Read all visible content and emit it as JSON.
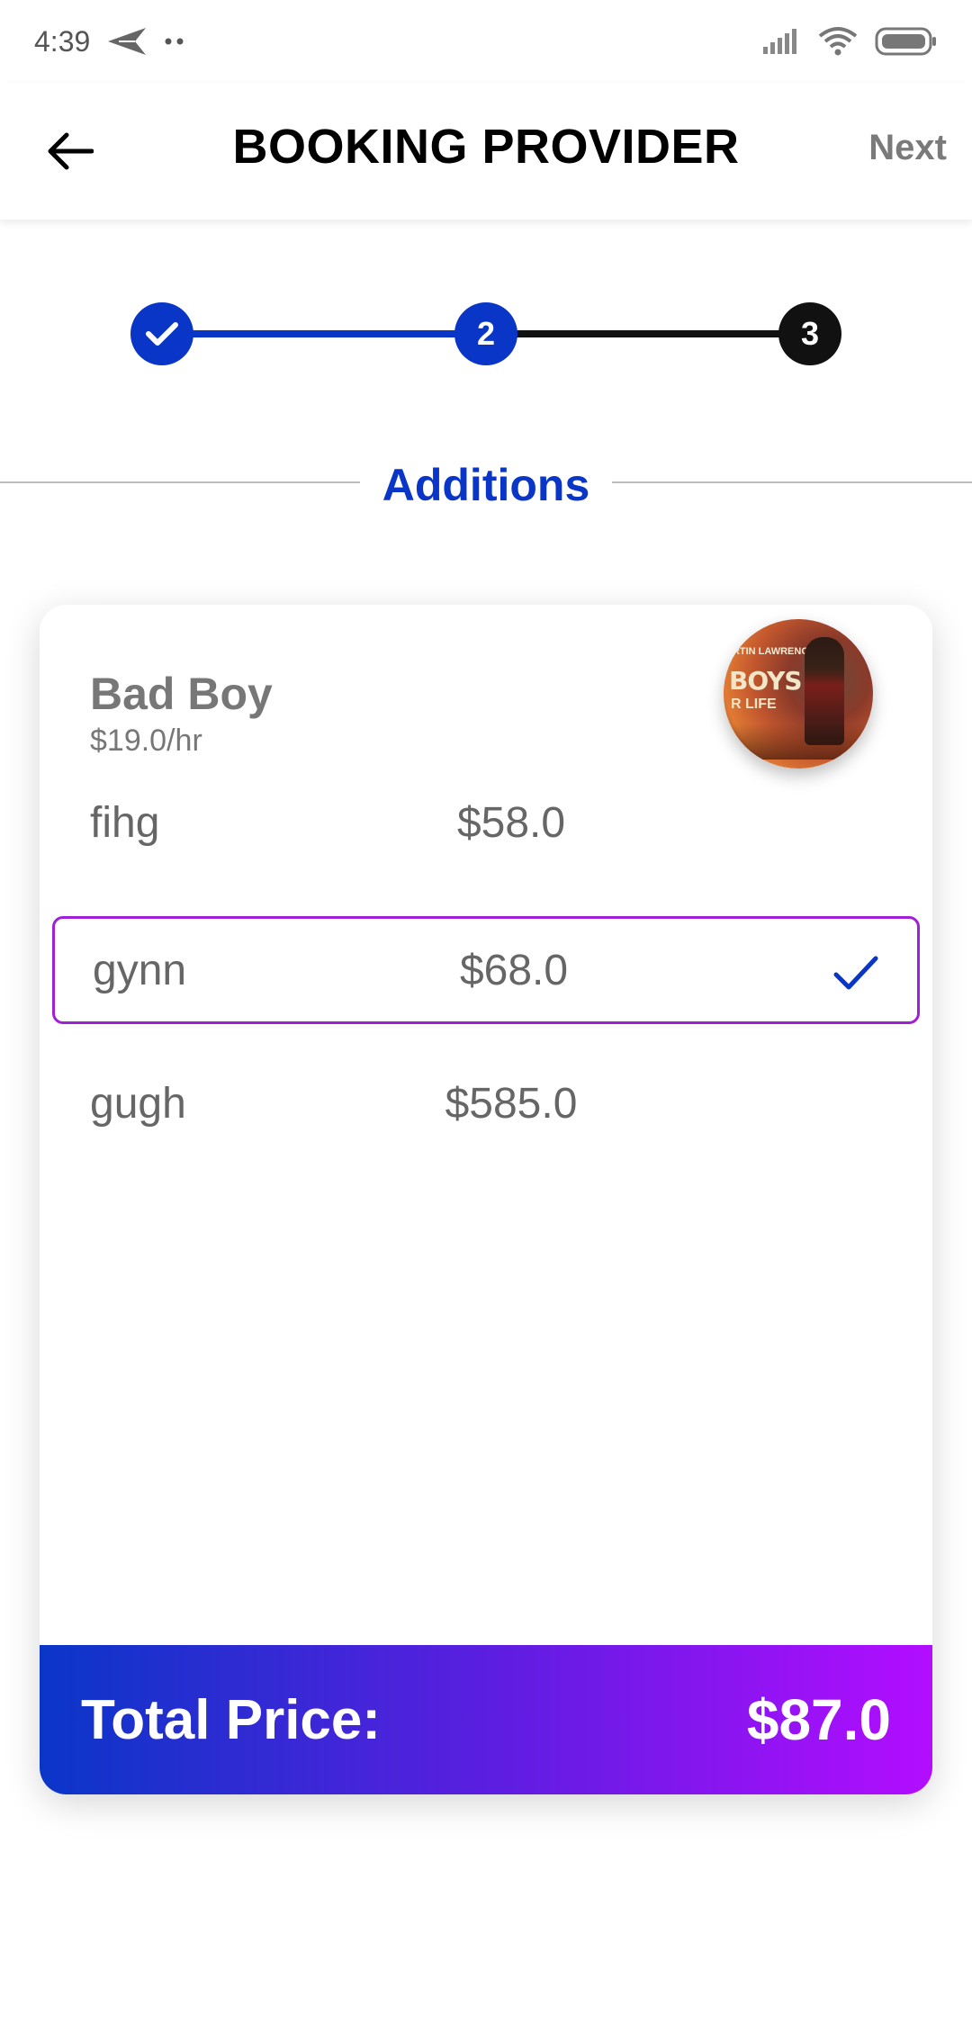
{
  "status_bar": {
    "time": "4:39",
    "left_icons": [
      "send-icon",
      "more-dots-icon"
    ],
    "right_icons": [
      "signal-icon",
      "wifi-icon",
      "battery-icon"
    ]
  },
  "app_bar": {
    "title": "BOOKING PROVIDER",
    "back_icon": "back-arrow-icon",
    "next_label": "Next"
  },
  "stepper": {
    "steps": [
      {
        "label": "",
        "state": "done",
        "icon": "check-icon"
      },
      {
        "label": "2",
        "state": "current"
      },
      {
        "label": "3",
        "state": "upcoming"
      }
    ]
  },
  "section": {
    "title": "Additions"
  },
  "provider": {
    "name": "Bad Boy",
    "rate": "$19.0/hr",
    "avatar_texts": {
      "top": "ARTIN LAWRENCE",
      "title": "BOYS",
      "sub": "R LIFE"
    }
  },
  "additions": [
    {
      "name": "fihg",
      "price": "$58.0",
      "selected": false
    },
    {
      "name": "gynn",
      "price": "$68.0",
      "selected": true
    },
    {
      "name": "gugh",
      "price": "$585.0",
      "selected": false
    }
  ],
  "total": {
    "label": "Total Price:",
    "value": "$87.0"
  },
  "colors": {
    "primary": "#0a36c8",
    "selected_border": "#a020d8",
    "gradient_end": "#b30dff",
    "muted_text": "#777777"
  }
}
